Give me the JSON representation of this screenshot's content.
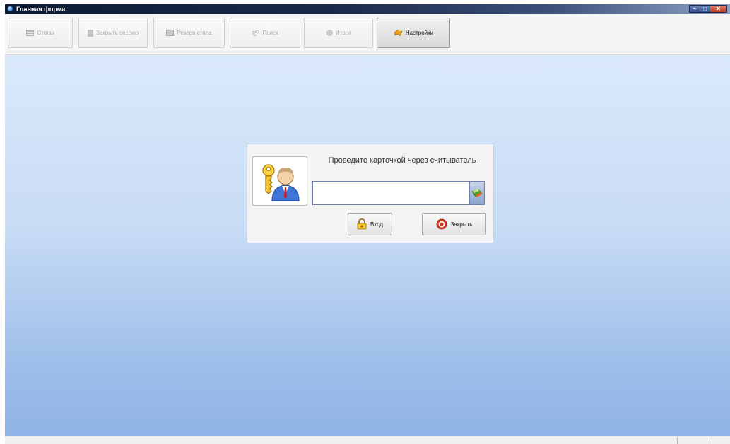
{
  "window": {
    "title": "Главная форма",
    "controls": {
      "minimize": "–",
      "maximize": "□",
      "close": "✕"
    }
  },
  "toolbar": {
    "buttons": [
      {
        "label": "Столы",
        "icon": "tables-icon",
        "enabled": false
      },
      {
        "label": "Закрыть сессию",
        "icon": "trash-icon",
        "enabled": false
      },
      {
        "label": "Резерв стола",
        "icon": "reserve-icon",
        "enabled": false
      },
      {
        "label": "Поиск",
        "icon": "search-icon",
        "enabled": false
      },
      {
        "label": "Итоги",
        "icon": "totals-icon",
        "enabled": false
      },
      {
        "label": "Настройки",
        "icon": "settings-icon",
        "enabled": true,
        "pressed": true
      }
    ]
  },
  "login": {
    "prompt": "Проведите карточкой через считыватель",
    "card_input": {
      "value": "",
      "placeholder": ""
    },
    "login_button": "Вход",
    "close_button": "Закрыть"
  },
  "colors": {
    "background_top": "#dbe9fb",
    "background_bottom": "#8fb3e6",
    "titlebar": "#0c1a33",
    "close_button_red": "#d23a22"
  }
}
